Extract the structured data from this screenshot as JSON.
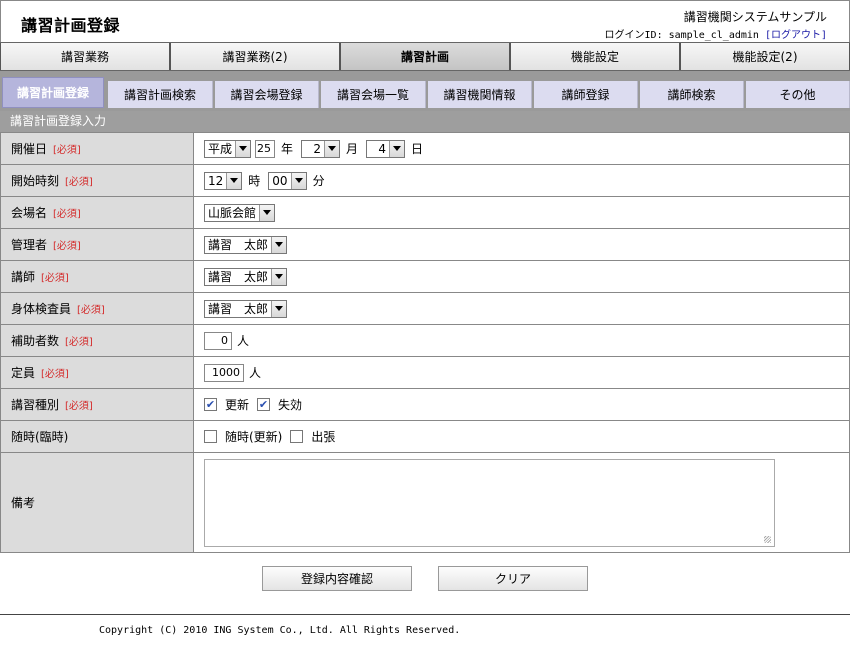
{
  "header": {
    "title": "講習計画登録",
    "system_name": "講習機関システムサンプル",
    "login_prefix": "ログインID: sample_cl_admin",
    "logout_label": "[ログアウト]"
  },
  "main_tabs": [
    "講習業務",
    "講習業務(2)",
    "講習計画",
    "機能設定",
    "機能設定(2)"
  ],
  "sub_tabs": [
    "講習計画登録",
    "講習計画検索",
    "講習会場登録",
    "講習会場一覧",
    "講習機関情報",
    "講師登録",
    "講師検索",
    "その他"
  ],
  "section_title": "講習計画登録入力",
  "required_mark": "[必須]",
  "form": {
    "date": {
      "label": "開催日",
      "era": "平成",
      "year": "25",
      "year_unit": "年",
      "month": "2",
      "month_unit": "月",
      "day": "4",
      "day_unit": "日"
    },
    "time": {
      "label": "開始時刻",
      "hour": "12",
      "hour_unit": "時",
      "minute": "00",
      "minute_unit": "分"
    },
    "venue": {
      "label": "会場名",
      "value": "山脈会館"
    },
    "manager": {
      "label": "管理者",
      "value": "講習　太郎"
    },
    "instructor": {
      "label": "講師",
      "value": "講習　太郎"
    },
    "examiner": {
      "label": "身体検査員",
      "value": "講習　太郎"
    },
    "assistants": {
      "label": "補助者数",
      "value": "0",
      "unit": "人"
    },
    "capacity": {
      "label": "定員",
      "value": "1000",
      "unit": "人"
    },
    "course_type": {
      "label": "講習種別",
      "options": [
        {
          "label": "更新",
          "checked": true
        },
        {
          "label": "失効",
          "checked": true
        }
      ]
    },
    "adhoc": {
      "label": "随時(臨時)",
      "options": [
        {
          "label": "随時(更新)",
          "checked": false
        },
        {
          "label": "出張",
          "checked": false
        }
      ]
    },
    "notes": {
      "label": "備考",
      "value": ""
    }
  },
  "buttons": {
    "confirm": "登録内容確認",
    "clear": "クリア"
  },
  "footer": {
    "copyright": "Copyright (C) 2010 ING System Co., Ltd. All Rights Reserved."
  }
}
